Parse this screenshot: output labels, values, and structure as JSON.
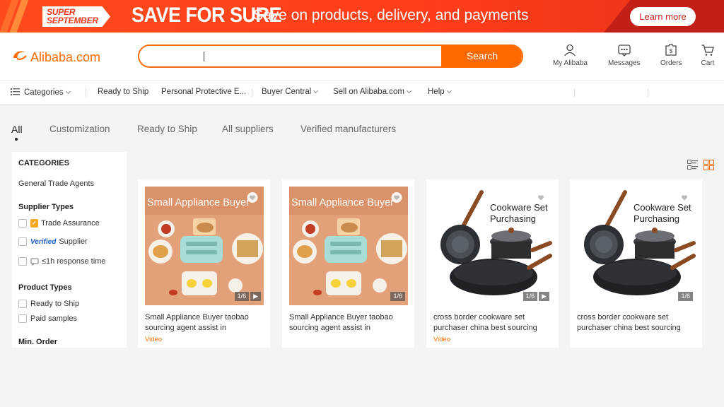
{
  "banner": {
    "tag_line1": "SUPER",
    "tag_line2": "SEPTEMBER",
    "title": "SAVE FOR SURE",
    "subtitle": "Save on products, delivery, and payments",
    "cta": "Learn more"
  },
  "header": {
    "logo": "Alibaba.com",
    "search": {
      "value": "",
      "button": "Search"
    },
    "nav": [
      {
        "label": "My Alibaba",
        "icon": "user-icon"
      },
      {
        "label": "Messages",
        "icon": "message-icon"
      },
      {
        "label": "Orders",
        "icon": "orders-icon"
      },
      {
        "label": "Cart",
        "icon": "cart-icon"
      }
    ]
  },
  "category_nav": {
    "categories": "Categories",
    "items": [
      "Ready to Ship",
      "Personal Protective E...",
      "Buyer Central",
      "Sell on Alibaba.com",
      "Help"
    ]
  },
  "tabs": [
    "All",
    "Customization",
    "Ready to Ship",
    "All suppliers",
    "Verified manufacturers"
  ],
  "sidebar": {
    "categories_title": "CATEGORIES",
    "general": "General Trade Agents",
    "supplier_types_title": "Supplier Types",
    "supplier_types": [
      "Trade Assurance",
      "Supplier",
      "≤1h response time"
    ],
    "verified_label": "Verified",
    "product_types_title": "Product Types",
    "product_types": [
      "Ready to Ship",
      "Paid samples"
    ],
    "min_order_title": "Min. Order"
  },
  "products": [
    {
      "image_text": "Small Appliance Buyer",
      "counter": "1/6",
      "title": "Small Appliance Buyer taobao sourcing agent assist in",
      "video": "Video"
    },
    {
      "image_text": "Small Appliance Buyer",
      "counter": "1/6",
      "title": "Small Appliance Buyer taobao sourcing agent assist in",
      "video": ""
    },
    {
      "image_text": "Cookware Set Purchasing",
      "counter": "1/6",
      "title": "cross border cookware set purchaser china best sourcing",
      "video": "Video"
    },
    {
      "image_text": "Cookware Set Purchasing",
      "counter": "1/6",
      "title": "cross border cookware set purchaser china best sourcing",
      "video": ""
    }
  ],
  "colors": {
    "brand": "#ff6a00",
    "banner": "#ff4a1c",
    "banner_dark": "#c21f18"
  }
}
